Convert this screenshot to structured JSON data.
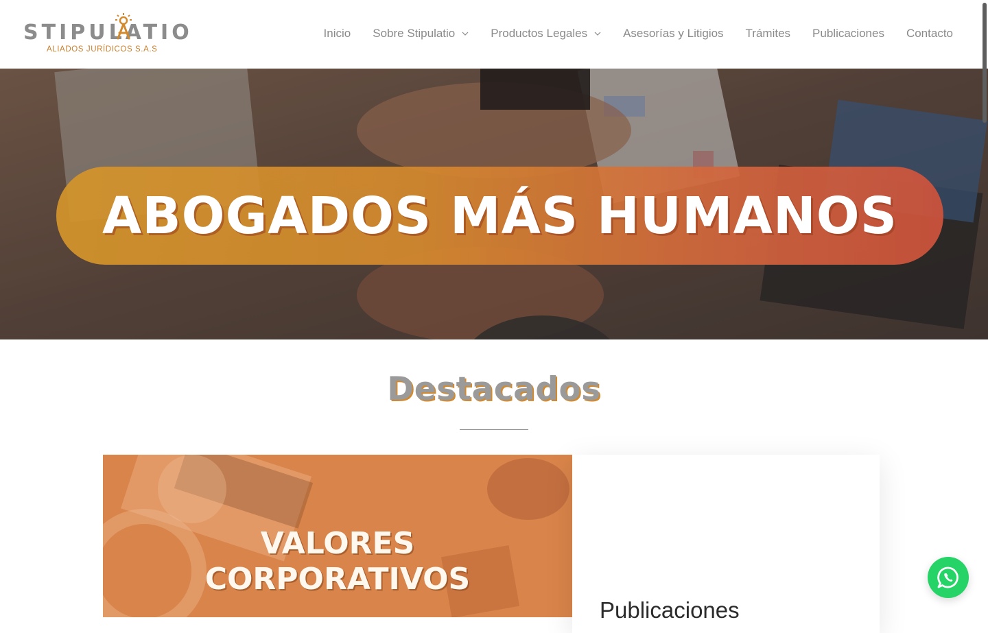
{
  "brand": {
    "name": "STIPULATIO",
    "subtitle": "ALIADOS JURÍDICOS S.A.S",
    "accent_color": "#d38a2e",
    "gray_color": "#8c8c8c"
  },
  "nav": {
    "items": [
      {
        "label": "Inicio",
        "has_dropdown": false
      },
      {
        "label": "Sobre Stipulatio",
        "has_dropdown": true
      },
      {
        "label": "Productos Legales",
        "has_dropdown": true
      },
      {
        "label": "Asesorías y Litigios",
        "has_dropdown": false
      },
      {
        "label": "Trámites",
        "has_dropdown": false
      },
      {
        "label": "Publicaciones",
        "has_dropdown": false
      },
      {
        "label": "Contacto",
        "has_dropdown": false
      }
    ]
  },
  "hero": {
    "title": "ABOGADOS MÁS HUMANOS",
    "background": "photo of stacked hands over a desk with laptops"
  },
  "featured": {
    "section_title": "Destacados",
    "image_title_line1": "VALORES",
    "image_title_line2": "CORPORATIVOS",
    "card_title": "Publicaciones"
  },
  "whatsapp": {
    "icon": "whatsapp-icon",
    "color": "#25d366"
  }
}
